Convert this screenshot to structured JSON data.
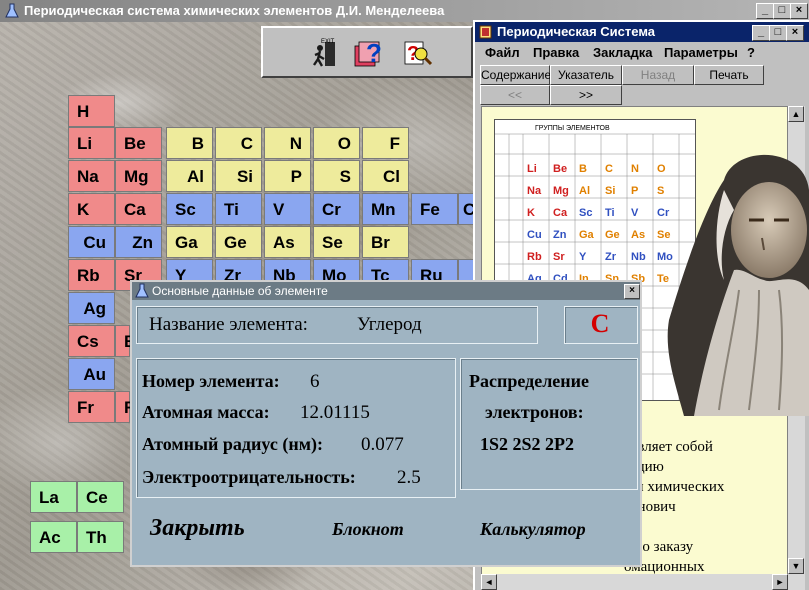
{
  "main_window": {
    "title": "Периодическая система химических элементов Д.И. Менделеева",
    "caption_buttons": [
      "_",
      "□",
      "×"
    ]
  },
  "toolbar": {
    "icons": [
      "exit-icon",
      "help-question-icon",
      "search-help-icon"
    ],
    "exit_label": "EXIT"
  },
  "elements": {
    "H": "H",
    "Li": "Li",
    "Be": "Be",
    "B": "B",
    "C": "C",
    "N": "N",
    "O": "O",
    "F": "F",
    "Na": "Na",
    "Mg": "Mg",
    "Al": "Al",
    "Si": "Si",
    "P": "P",
    "S": "S",
    "Cl": "Cl",
    "K": "K",
    "Ca": "Ca",
    "Sc": "Sc",
    "Ti": "Ti",
    "V": "V",
    "Cr": "Cr",
    "Mn": "Mn",
    "Fe": "Fe",
    "Co": "C",
    "Cu": "Cu",
    "Zn": "Zn",
    "Ga": "Ga",
    "Ge": "Ge",
    "As": "As",
    "Se": "Se",
    "Br": "Br",
    "Rb": "Rb",
    "Sr": "Sr",
    "Y": "Y",
    "Zr": "Zr",
    "Nb": "Nb",
    "Mo": "Mo",
    "Tc": "Tc",
    "Ru": "Ru",
    "Ag": "Ag",
    "Cs": "Cs",
    "Ba": "B",
    "Au": "Au",
    "Fr": "Fr",
    "Ra": "R",
    "La": "La",
    "Ce": "Ce",
    "Ac": "Ac",
    "Th": "Th"
  },
  "help_window": {
    "title": "Периодическая Система",
    "menu": [
      "Файл",
      "Правка",
      "Закладка",
      "Параметры",
      "?"
    ],
    "buttons": [
      "Содержание",
      "Указатель",
      "Назад",
      "Печать"
    ],
    "nav_prev": "<<",
    "nav_next": ">>",
    "table_header": "ГРУППЫ ЭЛЕМЕНТОВ",
    "text_lines": [
      "тавляет собой",
      "зацию",
      "мы химических",
      "ванович",
      "",
      "а по заказу",
      "омационных",
      "го"
    ]
  },
  "dialog": {
    "title": "Основные данные об элементе",
    "name_label": "Название элемента:",
    "name_value": "Углерод",
    "symbol": "C",
    "number_label": "Номер элемента:",
    "number_value": "6",
    "mass_label": "Атомная масса:",
    "mass_value": "12.01115",
    "radius_label": "Атомный радиус (нм):",
    "radius_value": "0.077",
    "electroneg_label": "Электроотрицательность:",
    "electroneg_value": "2.5",
    "distribution_title_1": "Распределение",
    "distribution_title_2": "электронов:",
    "distribution_value": "1S2 2S2 2P2",
    "close_button": "Закрыть",
    "notepad_button": "Блокнот",
    "calculator_button": "Калькулятор"
  },
  "colors": {
    "alkali": "#f08a8a",
    "p_block": "#eeeb9c",
    "d_block": "#8aa6f0",
    "f_block": "#a8f0a8",
    "symbol_red": "#d40000"
  }
}
